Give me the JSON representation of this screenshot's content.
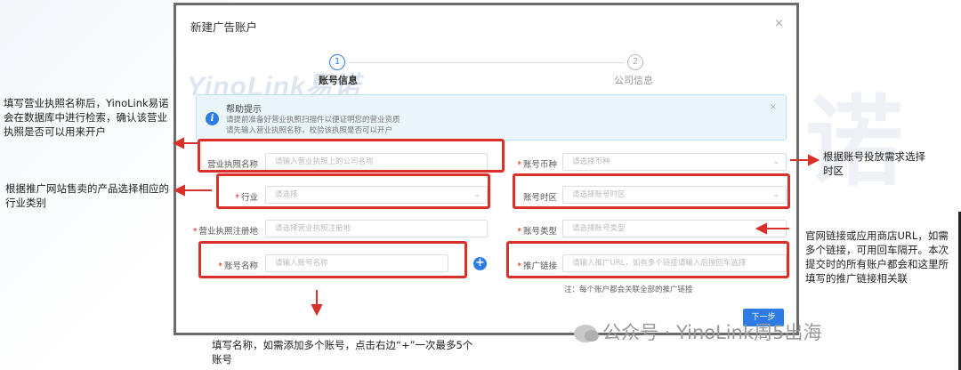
{
  "modal": {
    "title": "新建广告账户",
    "close": "×",
    "steps": [
      {
        "number": "1",
        "label": "账号信息"
      },
      {
        "number": "2",
        "label": "公司信息"
      }
    ],
    "watermark_logo": "YinoLink易诺"
  },
  "alert": {
    "icon": "i",
    "title": "帮助提示",
    "line1": "请提前准备好营业执照扫描件以便证明您的营业资质",
    "line2": "请先输入营业执照名称，校验该执照是否可以开户",
    "close": "×"
  },
  "form": {
    "license_name_label": "营业执照名称",
    "license_name_placeholder": "请输入营业执照上的公司名称",
    "currency_label": "账号币种",
    "currency_placeholder": "请选择币种",
    "industry_label": "行业",
    "industry_placeholder": "请选择",
    "timezone_label": "账号时区",
    "timezone_placeholder": "请选择账号时区",
    "region_label": "营业执照注册地",
    "region_placeholder": "请选择营业执照注册地",
    "account_type_label": "账号类型",
    "account_type_placeholder": "请选择账号类型",
    "account_name_label": "账号名称",
    "account_name_placeholder": "请输入账号名称",
    "promo_link_label": "推广链接",
    "promo_link_placeholder": "请输入推广URL，如有多个链接请输入后按回车选择",
    "add_button": "+",
    "note": "注：每个账户都会关联全部的推广链接",
    "next_button": "下一步"
  },
  "annotations": {
    "license": "填写营业执照名称后，YinoLink易诺会在数据库中进行检索，确认该营业执照是否可以用来开户",
    "industry": "根据推广网站售卖的产品选择相应的行业类别",
    "timezone": "根据账号投放需求选择时区",
    "link": "官网链接或应用商店URL，如需多个链接，可用回车隔开。本次提交时的所有账户都会和这里所填写的推广链接相关联",
    "name": "填写名称，如需添加多个账号，点击右边“+”一次最多5个账号"
  },
  "footer_watermark": "公众号 · YinoLink周5出海",
  "background_watermark": "诺",
  "colors": {
    "primary": "#2d7be5",
    "highlight": "#d9302a",
    "alert_bg": "#eaf6fc"
  }
}
